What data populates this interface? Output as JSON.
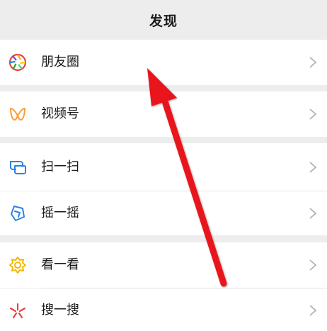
{
  "header": {
    "title": "发现"
  },
  "menu": {
    "moments": {
      "label": "朋友圈",
      "icon": "moments-aperture-icon"
    },
    "channels": {
      "label": "视频号",
      "icon": "channels-butterfly-icon"
    },
    "scan": {
      "label": "扫一扫",
      "icon": "scan-icon"
    },
    "shake": {
      "label": "摇一摇",
      "icon": "shake-icon"
    },
    "top_stories": {
      "label": "看一看",
      "icon": "top-stories-icon"
    },
    "search": {
      "label": "搜一搜",
      "icon": "search-sparkle-icon"
    }
  },
  "colors": {
    "background": "#ededed",
    "row": "#ffffff",
    "annotation_arrow": "#e8161d"
  }
}
